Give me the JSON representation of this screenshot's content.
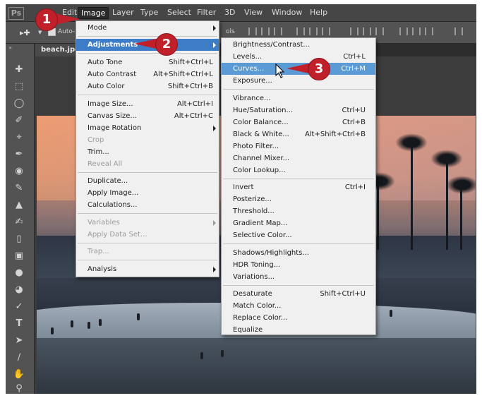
{
  "app": {
    "logo": "Ps"
  },
  "menubar": {
    "items": [
      "Edit",
      "Image",
      "Layer",
      "Type",
      "Select",
      "Filter",
      "3D",
      "View",
      "Window",
      "Help"
    ],
    "active": "Image"
  },
  "optionsbar": {
    "auto_label": "Auto-",
    "right_label": "ols"
  },
  "document": {
    "tab_label": "beach.jpg @"
  },
  "image_menu": {
    "items": [
      {
        "label": "Mode",
        "shortcut": "",
        "submenu": true,
        "disabled": false
      },
      {
        "label": "Adjustments",
        "shortcut": "",
        "submenu": true,
        "disabled": false,
        "highlighted": true
      },
      {
        "label": "Auto Tone",
        "shortcut": "Shift+Ctrl+L",
        "submenu": false,
        "disabled": false
      },
      {
        "label": "Auto Contrast",
        "shortcut": "Alt+Shift+Ctrl+L",
        "submenu": false,
        "disabled": false
      },
      {
        "label": "Auto Color",
        "shortcut": "Shift+Ctrl+B",
        "submenu": false,
        "disabled": false
      },
      {
        "label": "Image Size...",
        "shortcut": "Alt+Ctrl+I",
        "submenu": false,
        "disabled": false
      },
      {
        "label": "Canvas Size...",
        "shortcut": "Alt+Ctrl+C",
        "submenu": false,
        "disabled": false
      },
      {
        "label": "Image Rotation",
        "shortcut": "",
        "submenu": true,
        "disabled": false
      },
      {
        "label": "Crop",
        "shortcut": "",
        "submenu": false,
        "disabled": true
      },
      {
        "label": "Trim...",
        "shortcut": "",
        "submenu": false,
        "disabled": false
      },
      {
        "label": "Reveal All",
        "shortcut": "",
        "submenu": false,
        "disabled": true
      },
      {
        "label": "Duplicate...",
        "shortcut": "",
        "submenu": false,
        "disabled": false
      },
      {
        "label": "Apply Image...",
        "shortcut": "",
        "submenu": false,
        "disabled": false
      },
      {
        "label": "Calculations...",
        "shortcut": "",
        "submenu": false,
        "disabled": false
      },
      {
        "label": "Variables",
        "shortcut": "",
        "submenu": true,
        "disabled": true
      },
      {
        "label": "Apply Data Set...",
        "shortcut": "",
        "submenu": false,
        "disabled": true
      },
      {
        "label": "Trap...",
        "shortcut": "",
        "submenu": false,
        "disabled": true
      },
      {
        "label": "Analysis",
        "shortcut": "",
        "submenu": true,
        "disabled": false
      }
    ]
  },
  "adjustments_menu": {
    "items": [
      {
        "label": "Brightness/Contrast...",
        "shortcut": ""
      },
      {
        "label": "Levels...",
        "shortcut": "Ctrl+L"
      },
      {
        "label": "Curves...",
        "shortcut": "Ctrl+M",
        "highlighted": true
      },
      {
        "label": "Exposure...",
        "shortcut": ""
      },
      {
        "label": "Vibrance...",
        "shortcut": ""
      },
      {
        "label": "Hue/Saturation...",
        "shortcut": "Ctrl+U"
      },
      {
        "label": "Color Balance...",
        "shortcut": "Ctrl+B"
      },
      {
        "label": "Black & White...",
        "shortcut": "Alt+Shift+Ctrl+B"
      },
      {
        "label": "Photo Filter...",
        "shortcut": ""
      },
      {
        "label": "Channel Mixer...",
        "shortcut": ""
      },
      {
        "label": "Color Lookup...",
        "shortcut": ""
      },
      {
        "label": "Invert",
        "shortcut": "Ctrl+I"
      },
      {
        "label": "Posterize...",
        "shortcut": ""
      },
      {
        "label": "Threshold...",
        "shortcut": ""
      },
      {
        "label": "Gradient Map...",
        "shortcut": ""
      },
      {
        "label": "Selective Color...",
        "shortcut": ""
      },
      {
        "label": "Shadows/Highlights...",
        "shortcut": ""
      },
      {
        "label": "HDR Toning...",
        "shortcut": ""
      },
      {
        "label": "Variations...",
        "shortcut": ""
      },
      {
        "label": "Desaturate",
        "shortcut": "Shift+Ctrl+U"
      },
      {
        "label": "Match Color...",
        "shortcut": ""
      },
      {
        "label": "Replace Color...",
        "shortcut": ""
      },
      {
        "label": "Equalize",
        "shortcut": ""
      }
    ]
  },
  "callouts": [
    "1",
    "2",
    "3"
  ],
  "toolbar": {
    "tools": [
      "move-tool-icon",
      "marquee-tool-icon",
      "lasso-tool-icon",
      "quick-selection-tool-icon",
      "crop-tool-icon",
      "eyedropper-tool-icon",
      "healing-brush-tool-icon",
      "brush-tool-icon",
      "clone-stamp-tool-icon",
      "history-brush-tool-icon",
      "eraser-tool-icon",
      "gradient-tool-icon",
      "blur-tool-icon",
      "dodge-tool-icon",
      "pen-tool-icon",
      "type-tool-icon",
      "path-selection-tool-icon",
      "line-tool-icon",
      "hand-tool-icon",
      "zoom-tool-icon"
    ]
  },
  "colors": {
    "menu_highlight": "#3d7cc6",
    "callout": "#c0202a",
    "ui_dark": "#535353"
  }
}
